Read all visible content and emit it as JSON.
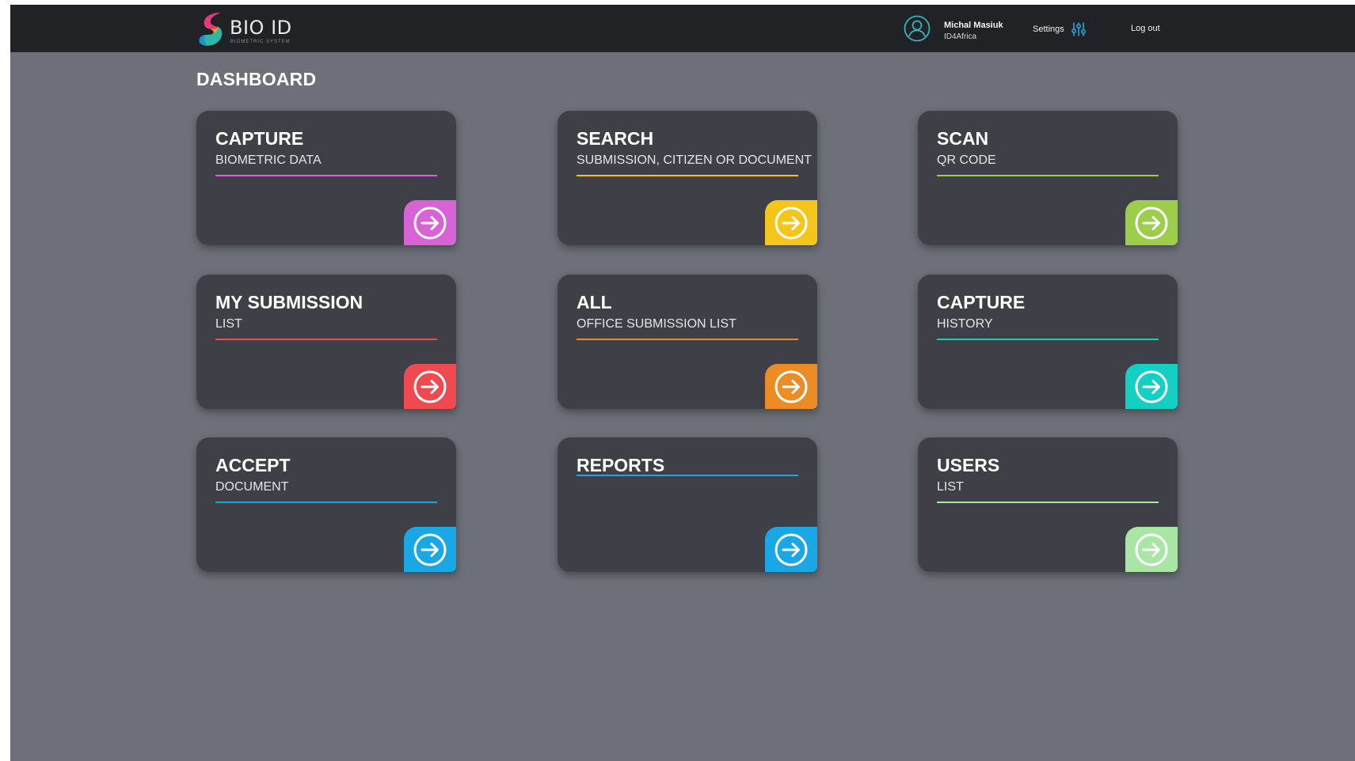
{
  "brand": {
    "name": "BIO ID",
    "tagline": "BIOMETRIC SYSTEM"
  },
  "user": {
    "name": "Michal Masiuk",
    "org": "ID4Africa"
  },
  "nav": {
    "settings_label": "Settings",
    "logout_label": "Log out"
  },
  "page": {
    "title": "DASHBOARD"
  },
  "colors": {
    "frame_background": "#6d7079",
    "topbar_background": "#212226",
    "card_background": "#3f4047",
    "settings_icon": "#1ea7e1"
  },
  "cards": [
    {
      "id": "capture-biometric",
      "title": "CAPTURE",
      "subtitle": "BIOMETRIC DATA",
      "accent": "#d863d6",
      "icon": "arrow-right-circle-icon"
    },
    {
      "id": "search",
      "title": "SEARCH",
      "subtitle": "SUBMISSION, CITIZEN OR DOCUMENT",
      "accent": "#f4c51b",
      "icon": "arrow-right-circle-icon"
    },
    {
      "id": "scan-qr",
      "title": "SCAN",
      "subtitle": "QR CODE",
      "accent": "#9ccd4b",
      "icon": "arrow-right-circle-icon"
    },
    {
      "id": "my-submission",
      "title": "MY SUBMISSION",
      "subtitle": "LIST",
      "accent": "#ef4a4f",
      "icon": "arrow-right-circle-icon"
    },
    {
      "id": "all-office",
      "title": "ALL",
      "subtitle": "OFFICE SUBMISSION LIST",
      "accent": "#ec8c25",
      "icon": "arrow-right-circle-icon"
    },
    {
      "id": "capture-history",
      "title": "CAPTURE",
      "subtitle": "HISTORY",
      "accent": "#14d0c4",
      "icon": "arrow-right-circle-icon"
    },
    {
      "id": "accept-document",
      "title": "ACCEPT",
      "subtitle": "DOCUMENT",
      "accent": "#1aa7e6",
      "icon": "arrow-right-circle-icon"
    },
    {
      "id": "reports",
      "title": "REPORTS",
      "subtitle": "",
      "accent": "#1aa7e6",
      "icon": "arrow-right-circle-icon"
    },
    {
      "id": "users",
      "title": "USERS",
      "subtitle": "LIST",
      "accent": "#a9e6a6",
      "icon": "arrow-right-circle-icon"
    }
  ]
}
